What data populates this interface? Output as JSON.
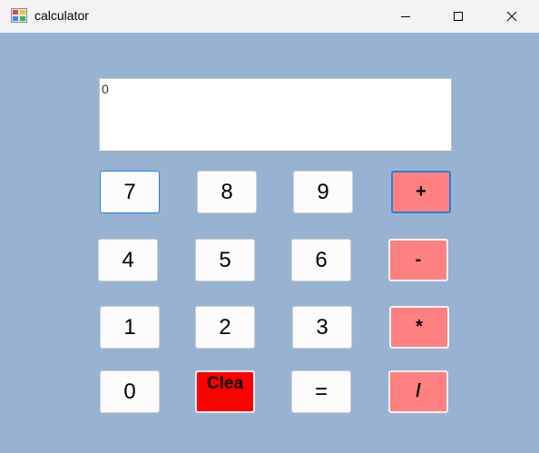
{
  "window": {
    "title": "calculator",
    "icon": "app-icon"
  },
  "titlebar_controls": [
    "minimize-icon",
    "maximize-icon",
    "close-icon"
  ],
  "display": {
    "value": "0"
  },
  "buttons": {
    "seven": "7",
    "eight": "8",
    "nine": "9",
    "plus": "+",
    "four": "4",
    "five": "5",
    "six": "6",
    "minus": "-",
    "one": "1",
    "two": "2",
    "three": "3",
    "multiply": "*",
    "zero": "0",
    "clear": "Clea",
    "equals": "=",
    "divide": "/"
  },
  "colors": {
    "background": "#98b3d1",
    "operator": "#ff8080",
    "clear": "#ff0000",
    "focus_border": "#2c7fd6"
  }
}
